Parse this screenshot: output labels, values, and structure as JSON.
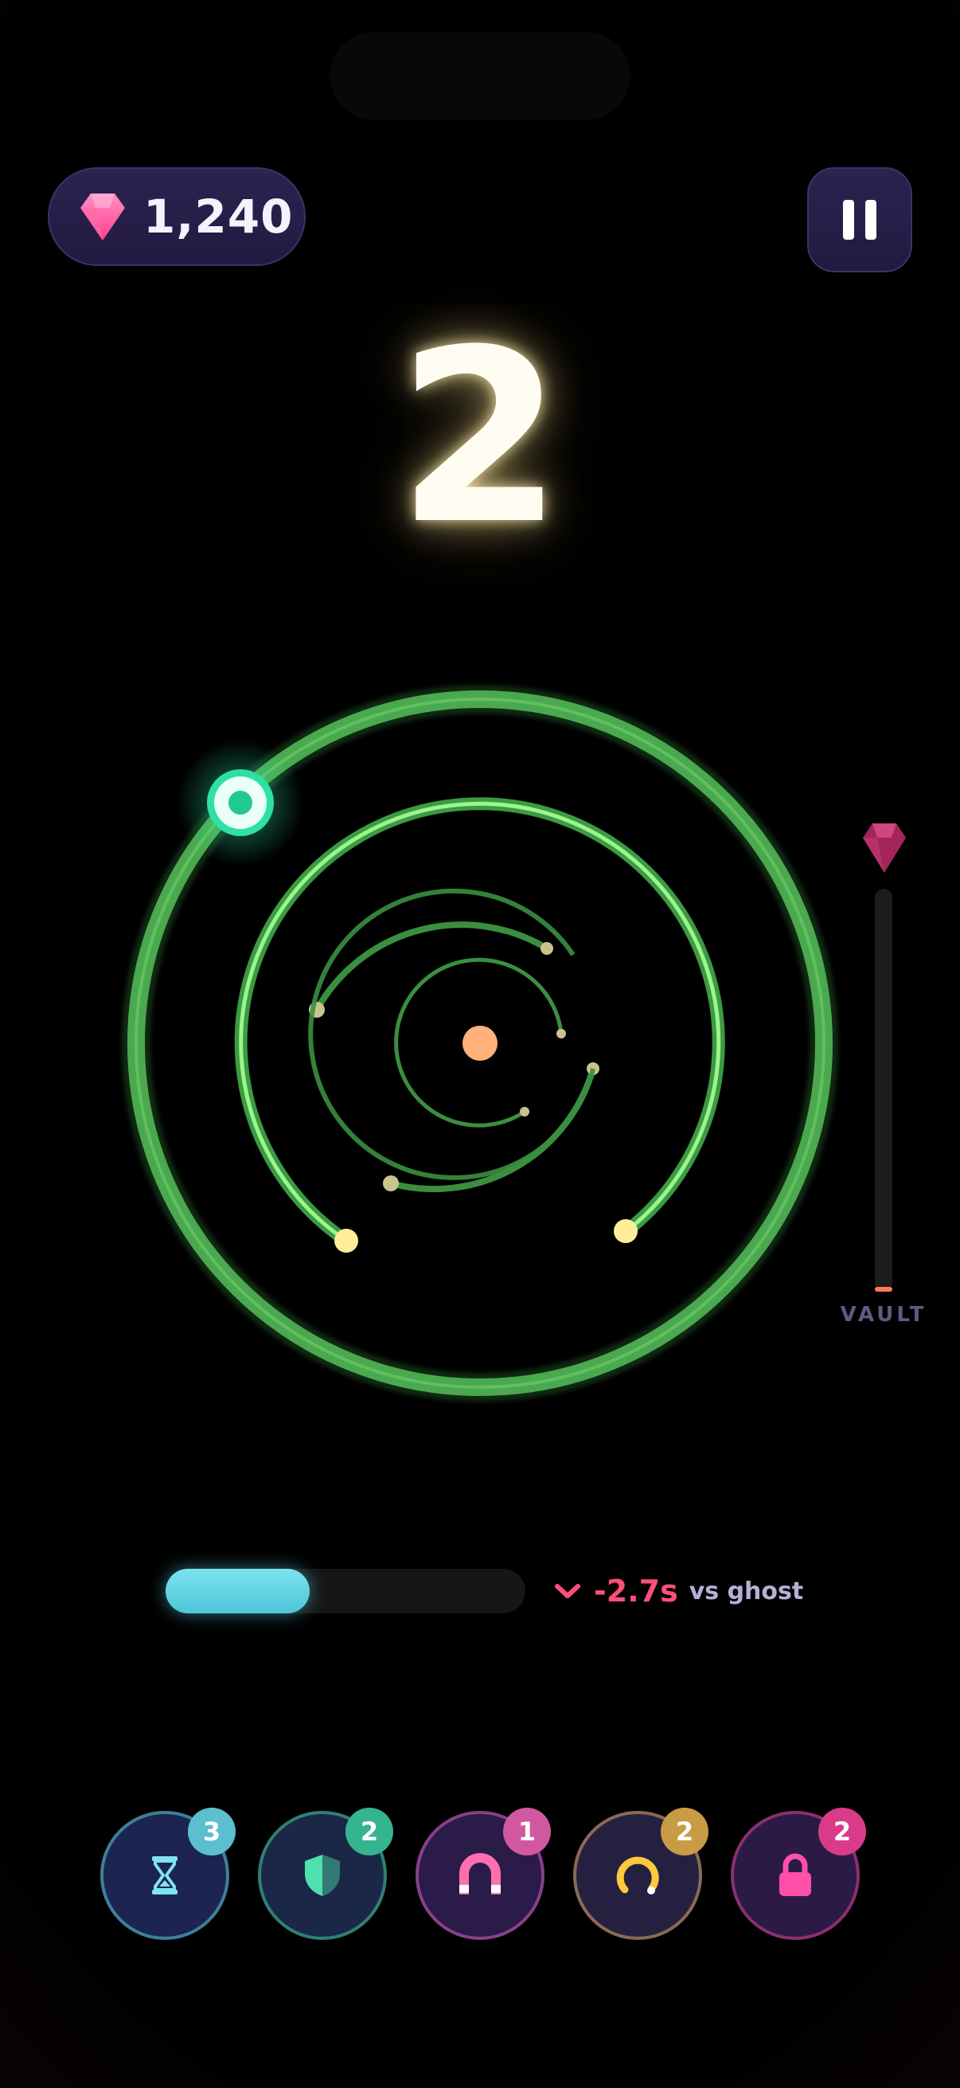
{
  "hud": {
    "gems": "1,240",
    "countdown": "2"
  },
  "vault": {
    "label": "VAULT",
    "fill_fraction": 0.012
  },
  "race": {
    "progress_fraction": 0.4,
    "delta": "-2.7s",
    "vs_label": "vs ghost",
    "direction": "down"
  },
  "powerups": [
    {
      "name": "hourglass",
      "icon": "hourglass-icon",
      "count": "3",
      "ring": "#3f7f99",
      "bg": "#1c2450",
      "badge": "#5bbfcf",
      "iconColor": "#7fe3f0"
    },
    {
      "name": "shield",
      "icon": "shield-icon",
      "count": "2",
      "ring": "#2f8074",
      "bg": "#1b2747",
      "badge": "#35b58f",
      "iconColor": "#4fe0ae"
    },
    {
      "name": "magnet",
      "icon": "magnet-icon",
      "count": "1",
      "ring": "#8a3f8a",
      "bg": "#2a1b48",
      "badge": "#d1589f",
      "iconColor": "#ff6fb0"
    },
    {
      "name": "ring",
      "icon": "ring-icon",
      "count": "2",
      "ring": "#8a6a55",
      "bg": "#262040",
      "badge": "#c89b45",
      "iconColor": "#ffc93d"
    },
    {
      "name": "lock",
      "icon": "lock-icon",
      "count": "2",
      "ring": "#8a2f6e",
      "bg": "#2b1a45",
      "badge": "#d93b8a",
      "iconColor": "#ff4fa8"
    }
  ],
  "colors": {
    "ring_green": "#3e9b44",
    "ring_bright": "#9af58c",
    "runner": "#33d6a0",
    "core": "#ffb27a",
    "gem": "#ff4f9a"
  }
}
